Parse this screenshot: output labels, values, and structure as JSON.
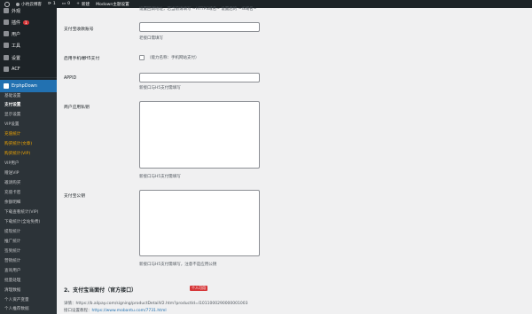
{
  "adminbar": {
    "site_name": "小坑云博客",
    "updates_count": "1",
    "comments_count": "0",
    "new_label": "新建",
    "theme_settings_label": "Modown主题设置"
  },
  "sidebar": {
    "appearance": "外观",
    "plugins": "插件",
    "plugins_badge": "1",
    "users": "用户",
    "tools": "工具",
    "settings": "设置",
    "acf": "ACF",
    "erphpdown": "ErphpDown",
    "submenu": [
      "基础设置",
      "支付设置",
      "显示设置",
      "VIP设置",
      "充值统计",
      "购买统计(文章)",
      "购买统计(VIP)",
      "VIP用户",
      "赠送VIP",
      "邀请购买",
      "充值卡密",
      "余额明细",
      "下载查看统计(VIP)",
      "下载统计(全站免费)",
      "提现统计",
      "推广统计",
      "签到统计",
      "营销统计",
      "查询用户",
      "批量处理",
      "清理数据",
      "个人资产变量",
      "个人推荐数据"
    ]
  },
  "main": {
    "top_cut_text": "设置回调地址，若当前请填写 ~HTTPS域名~ 设置后的 ~IS域名~",
    "account_label": "支付宝收款账号",
    "account_desc": "老接口需填写",
    "mobile_h5_label": "启用手机端H5支付",
    "mobile_h5_desc": "（能力名称：手机网站支付）",
    "appid_label": "APPID",
    "appid_desc": "新接口与H5支付需填写",
    "private_key_label": "商户应用私钥",
    "private_key_desc": "新接口与H5支付需填写",
    "public_key_label": "支付宝公钥",
    "public_key_desc": "新接口与H5支付需填写，注意不是应用公钥",
    "section_title": "2、支付宝当面付（官方接口）",
    "section_tag": "个人可用",
    "detail_label": "详情：",
    "detail_url": "https://b.alipay.com/signing/productDetailV2.htm?productId=I1011000290000001003",
    "tutorial_label": "接口设置教程：",
    "tutorial_url": "https://www.mobantu.com/7731.html"
  }
}
